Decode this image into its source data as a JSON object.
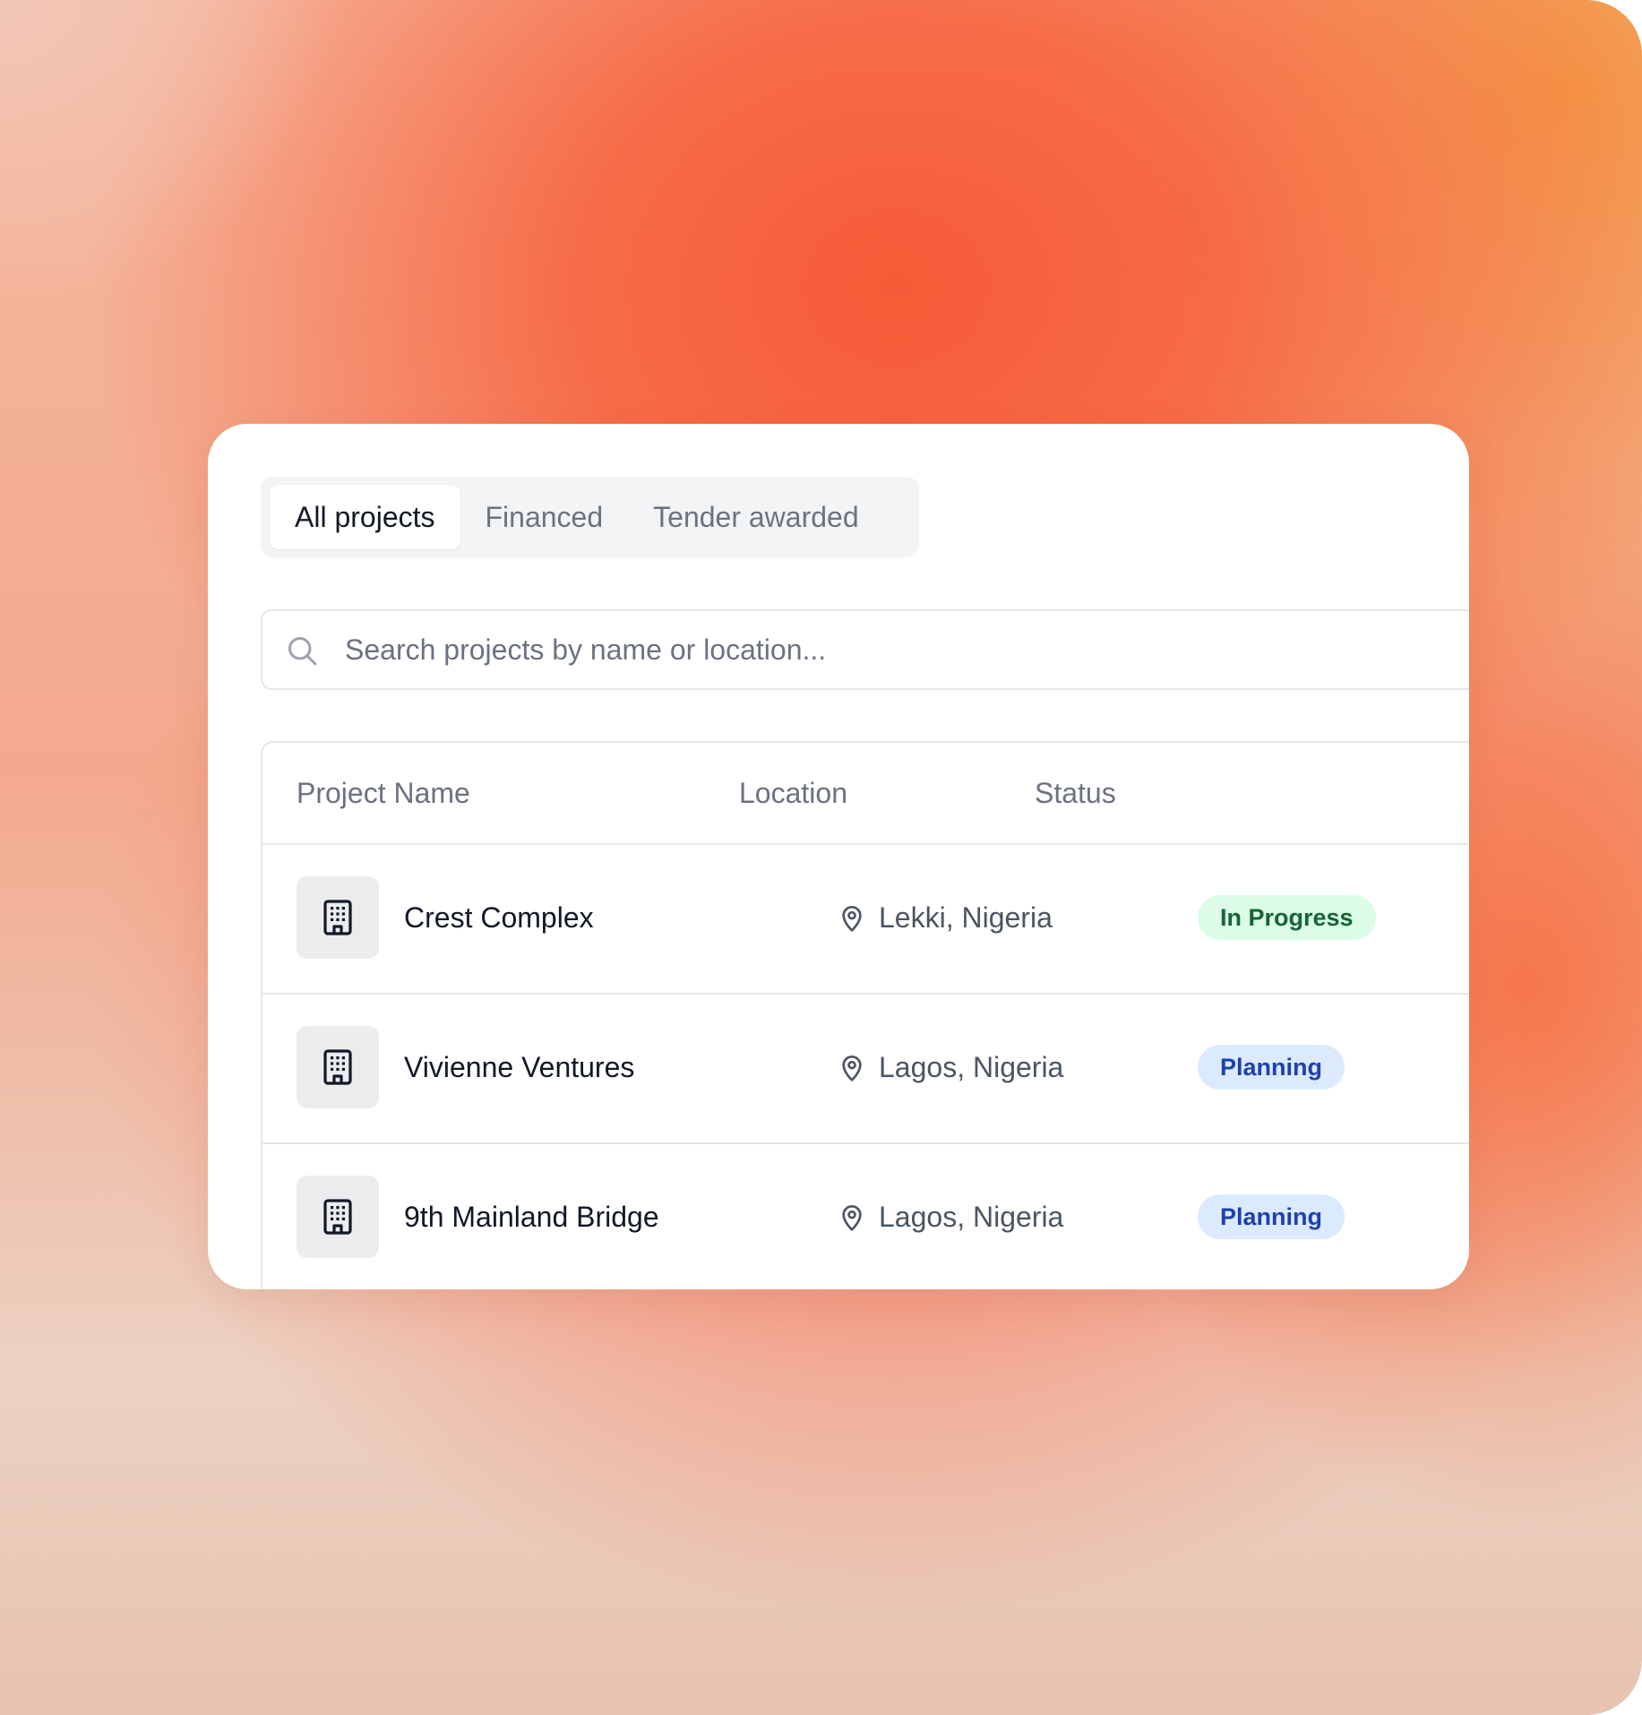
{
  "tabs": [
    {
      "label": "All projects",
      "active": true
    },
    {
      "label": "Financed",
      "active": false
    },
    {
      "label": "Tender awarded",
      "active": false
    }
  ],
  "search": {
    "placeholder": "Search projects by name or location...",
    "value": ""
  },
  "table": {
    "headers": [
      "Project Name",
      "Location",
      "Status"
    ],
    "rows": [
      {
        "name": "Crest Complex",
        "location": "Lekki, Nigeria",
        "status": "In Progress",
        "status_kind": "progress"
      },
      {
        "name": "Vivienne Ventures",
        "location": "Lagos, Nigeria",
        "status": "Planning",
        "status_kind": "planning"
      },
      {
        "name": "9th Mainland Bridge",
        "location": "Lagos, Nigeria",
        "status": "Planning",
        "status_kind": "planning"
      }
    ]
  },
  "icons": {
    "search": "search-icon",
    "row": "building-icon",
    "location": "map-pin-icon"
  },
  "colors": {
    "accent_orange": "#f75a37",
    "status_progress_bg": "#dcfce7",
    "status_progress_text": "#166534",
    "status_planning_bg": "#dbeafe",
    "status_planning_text": "#1e40af"
  }
}
